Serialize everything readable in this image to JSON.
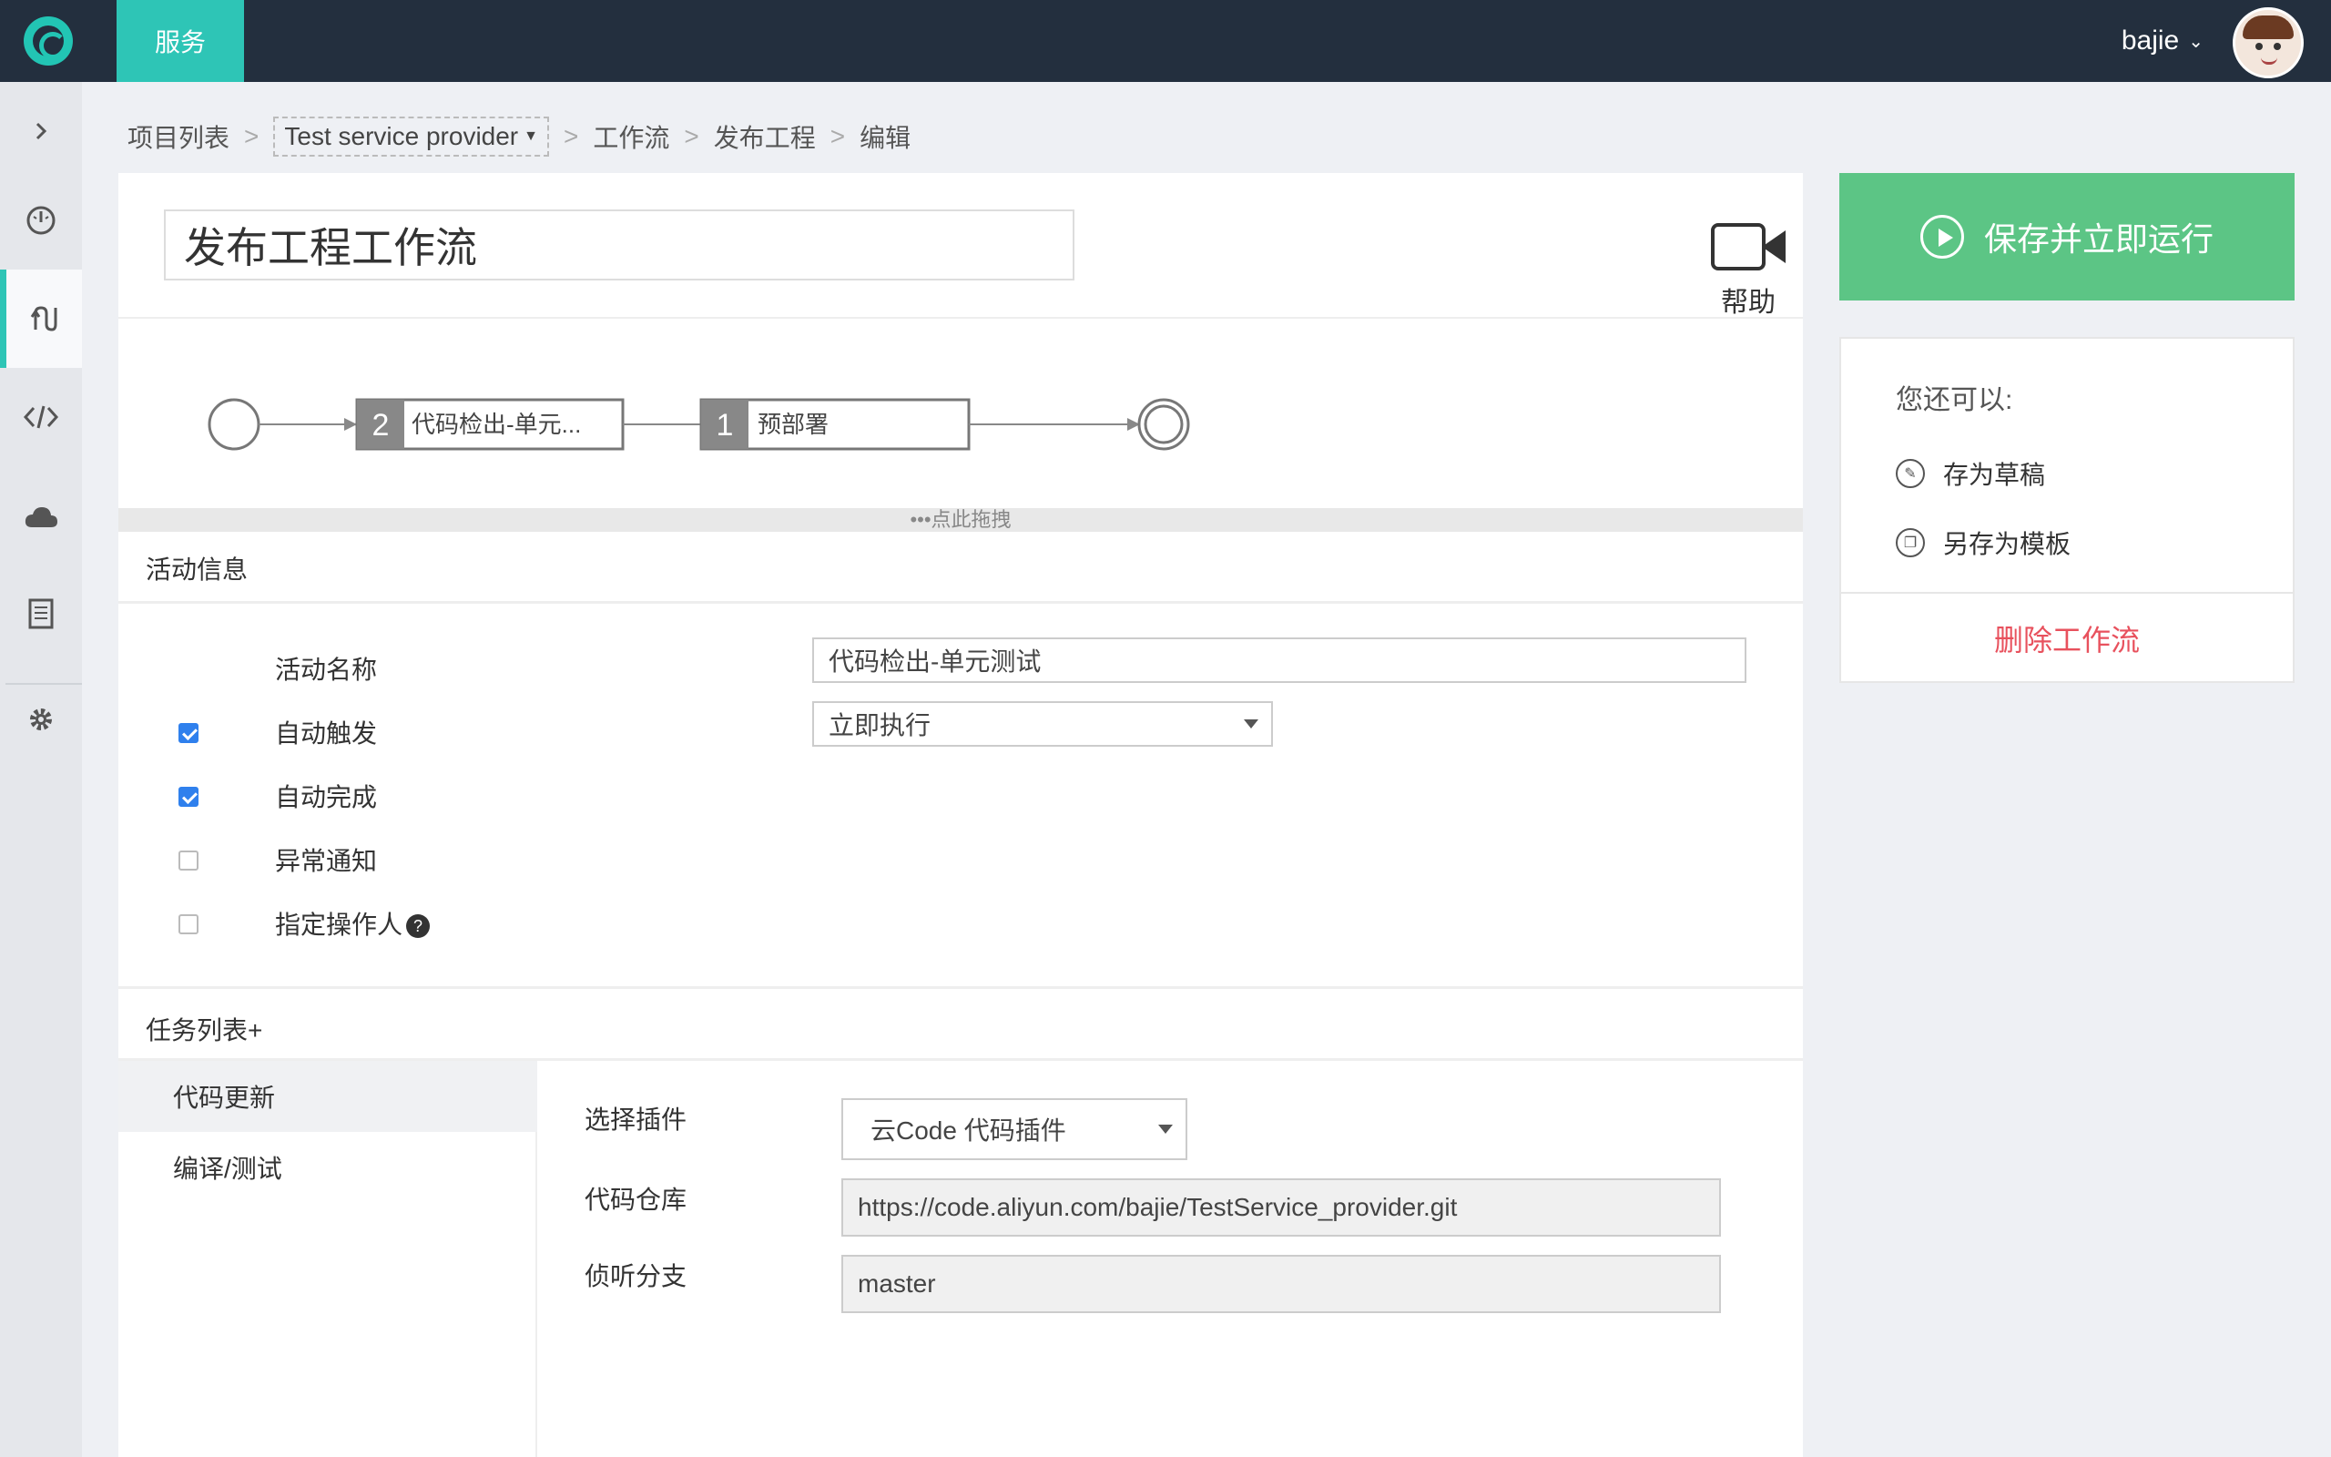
{
  "topbar": {
    "nav_tab": "服务",
    "username": "bajie"
  },
  "sidebar": {
    "items": [
      {
        "icon": "chevron-right-icon"
      },
      {
        "icon": "dashboard-icon"
      },
      {
        "icon": "workflow-icon"
      },
      {
        "icon": "code-icon"
      },
      {
        "icon": "cloud-icon"
      },
      {
        "icon": "document-icon"
      },
      {
        "icon": "gear-icon"
      }
    ]
  },
  "breadcrumb": {
    "items": [
      "项目列表",
      "Test service provider",
      "工作流",
      "发布工程",
      "编辑"
    ],
    "separator": ">"
  },
  "workflow": {
    "title": "发布工程工作流",
    "help_label": "帮助"
  },
  "flow": {
    "nodes": [
      {
        "num": "2",
        "label": "代码检出-单元..."
      },
      {
        "num": "1",
        "label": "预部署"
      }
    ],
    "drag_hint": "•••点此拖拽"
  },
  "activity": {
    "section_title": "活动信息",
    "name_label": "活动名称",
    "name_value": "代码检出-单元测试",
    "auto_trigger_label": "自动触发",
    "auto_trigger_checked": true,
    "trigger_select": "立即执行",
    "auto_complete_label": "自动完成",
    "auto_complete_checked": true,
    "exception_notify_label": "异常通知",
    "exception_notify_checked": false,
    "assign_operator_label": "指定操作人",
    "assign_operator_checked": false,
    "help_mark": "?"
  },
  "tasks": {
    "section_title": "任务列表+",
    "items": [
      "代码更新",
      "编译/测试"
    ],
    "plugin_label": "选择插件",
    "plugin_value": "云Code 代码插件",
    "repo_label": "代码仓库",
    "repo_value": "https://code.aliyun.com/bajie/TestService_provider.git",
    "branch_label": "侦听分支",
    "branch_value": "master"
  },
  "actions": {
    "run_label": "保存并立即运行",
    "alt_title": "您还可以:",
    "save_draft": "存为草稿",
    "save_template": "另存为模板",
    "delete": "删除工作流"
  },
  "colors": {
    "topbar": "#232f3e",
    "accent_teal": "#2ec5b6",
    "run_green": "#5cc585",
    "delete_red": "#e8515d",
    "checkbox_blue": "#2f80ed"
  }
}
